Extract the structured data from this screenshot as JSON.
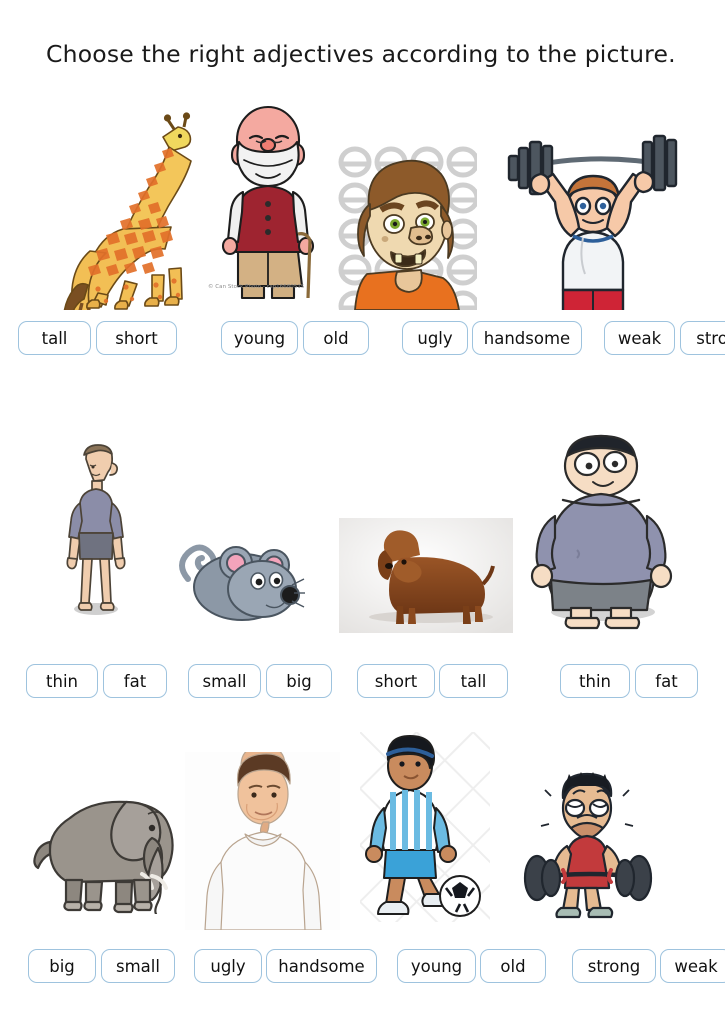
{
  "worksheet": {
    "title": "Choose the right adjectives according to the picture."
  },
  "rows": [
    {
      "row_id": "row-1",
      "items": [
        {
          "picture": {
            "name": "giraffe-picture",
            "subject": "giraffe",
            "alt": "Tall giraffe illustration standing in profile"
          },
          "options": [
            "tall",
            "short"
          ]
        },
        {
          "picture": {
            "name": "old-man-picture",
            "subject": "old man",
            "alt": "Cartoon bald old man with white beard, red vest and cane",
            "watermark": "© Can Stock Photo - csp16680515"
          },
          "options": [
            "young",
            "old"
          ]
        },
        {
          "picture": {
            "name": "ugly-face-picture",
            "subject": "ugly man",
            "alt": "Cartoon ugly man face with crooked teeth and orange shirt"
          },
          "options": [
            "ugly",
            "handsome"
          ]
        },
        {
          "picture": {
            "name": "strong-weightlifter-picture",
            "subject": "strong man",
            "alt": "Muscular cartoon man lifting a heavy barbell overhead"
          },
          "options": [
            "weak",
            "strong"
          ]
        }
      ]
    },
    {
      "row_id": "row-2",
      "items": [
        {
          "picture": {
            "name": "thin-man-picture",
            "subject": "thin man",
            "alt": "Skinny cartoon man standing in grey t-shirt and shorts"
          },
          "options": [
            "thin",
            "fat"
          ]
        },
        {
          "picture": {
            "name": "mouse-picture",
            "subject": "mouse",
            "alt": "Small grey cartoon mouse with pink ears and long tail"
          },
          "options": [
            "small",
            "big"
          ]
        },
        {
          "picture": {
            "name": "dachshund-picture",
            "subject": "dachshund dog",
            "alt": "Photo of a short brown dachshund dog"
          },
          "options": [
            "short",
            "tall"
          ]
        },
        {
          "picture": {
            "name": "fat-man-picture",
            "subject": "fat man",
            "alt": "Overweight cartoon man in purple t-shirt and grey shorts"
          },
          "options": [
            "thin",
            "fat"
          ]
        }
      ]
    },
    {
      "row_id": "row-3",
      "items": [
        {
          "picture": {
            "name": "elephant-picture",
            "subject": "elephant",
            "alt": "Big grey elephant illustration walking"
          },
          "options": [
            "big",
            "small"
          ]
        },
        {
          "picture": {
            "name": "handsome-man-picture",
            "subject": "handsome man",
            "alt": "Handsome young man in white t-shirt"
          },
          "options": [
            "ugly",
            "handsome"
          ]
        },
        {
          "picture": {
            "name": "soccer-boy-picture",
            "subject": "young boy",
            "alt": "Young boy in blue striped kit with a soccer ball"
          },
          "options": [
            "young",
            "old"
          ]
        },
        {
          "picture": {
            "name": "weak-lifter-picture",
            "subject": "weak man",
            "alt": "Skinny straining cartoon man struggling to lift a barbell"
          },
          "options": [
            "strong",
            "weak"
          ]
        }
      ]
    }
  ],
  "colors": {
    "box_border": "#9ec3de",
    "text": "#111111",
    "page_background": "#ffffff"
  }
}
